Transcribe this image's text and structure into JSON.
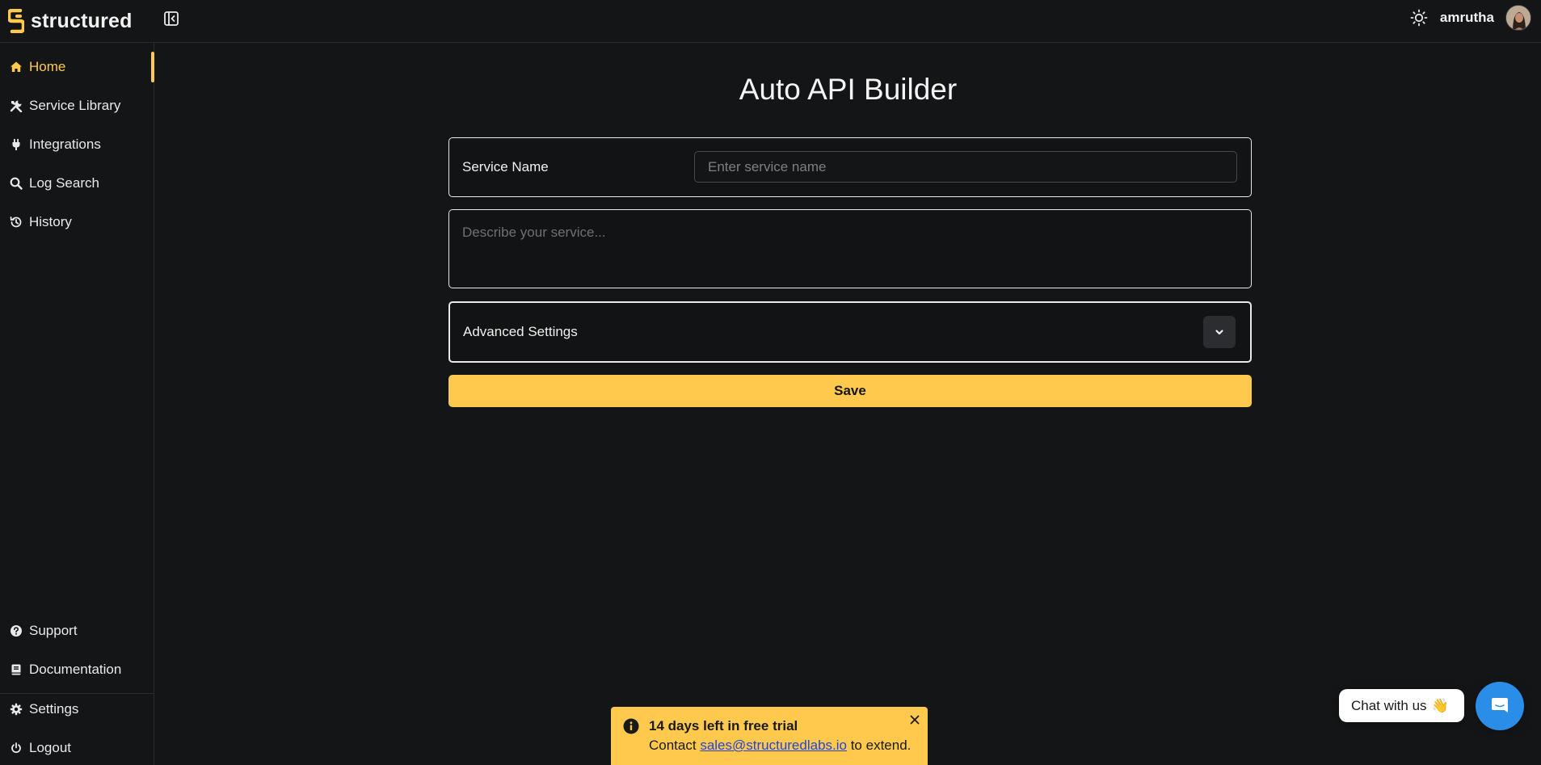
{
  "app": {
    "logo_text": "structured",
    "username": "amrutha",
    "accent_color": "#ffc94d",
    "background_color": "#141516"
  },
  "sidebar": {
    "items": [
      {
        "label": "Home",
        "icon": "home-icon",
        "active": true
      },
      {
        "label": "Service Library",
        "icon": "tools-icon",
        "active": false
      },
      {
        "label": "Integrations",
        "icon": "plug-icon",
        "active": false
      },
      {
        "label": "Log Search",
        "icon": "search-icon",
        "active": false
      },
      {
        "label": "History",
        "icon": "history-icon",
        "active": false
      }
    ],
    "bottom_items": [
      {
        "label": "Support",
        "icon": "help-circle-icon"
      },
      {
        "label": "Documentation",
        "icon": "book-icon"
      },
      {
        "label": "Settings",
        "icon": "gear-icon"
      },
      {
        "label": "Logout",
        "icon": "power-icon"
      }
    ]
  },
  "main": {
    "title": "Auto API Builder",
    "service_name_label": "Service Name",
    "service_name_value": "",
    "service_name_placeholder": "Enter service name",
    "description_value": "",
    "description_placeholder": "Describe your service...",
    "advanced_settings_label": "Advanced Settings",
    "save_label": "Save"
  },
  "trial_banner": {
    "title": "14 days left in free trial",
    "body_prefix": "Contact ",
    "email": "sales@structuredlabs.io",
    "body_suffix": " to extend.",
    "color": "#ffc94d"
  },
  "chat": {
    "label": "Chat with us",
    "emoji": "👋",
    "fab_color": "#2a8ee9"
  }
}
